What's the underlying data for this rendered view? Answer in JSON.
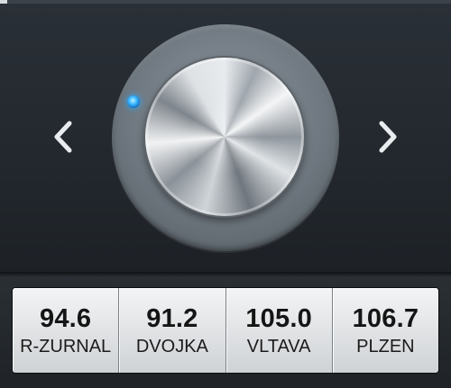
{
  "tuner": {
    "prev_icon": "chevron-left-icon",
    "next_icon": "chevron-right-icon",
    "dial_indicator_color": "#36b4ff"
  },
  "presets": [
    {
      "frequency": "94.6",
      "name": "R-ZURNAL"
    },
    {
      "frequency": "91.2",
      "name": "DVOJKA"
    },
    {
      "frequency": "105.0",
      "name": "VLTAVA"
    },
    {
      "frequency": "106.7",
      "name": "PLZEN"
    }
  ],
  "colors": {
    "background": "#22272d",
    "preset_button": "#e3e5e7",
    "preset_text": "#151515"
  }
}
